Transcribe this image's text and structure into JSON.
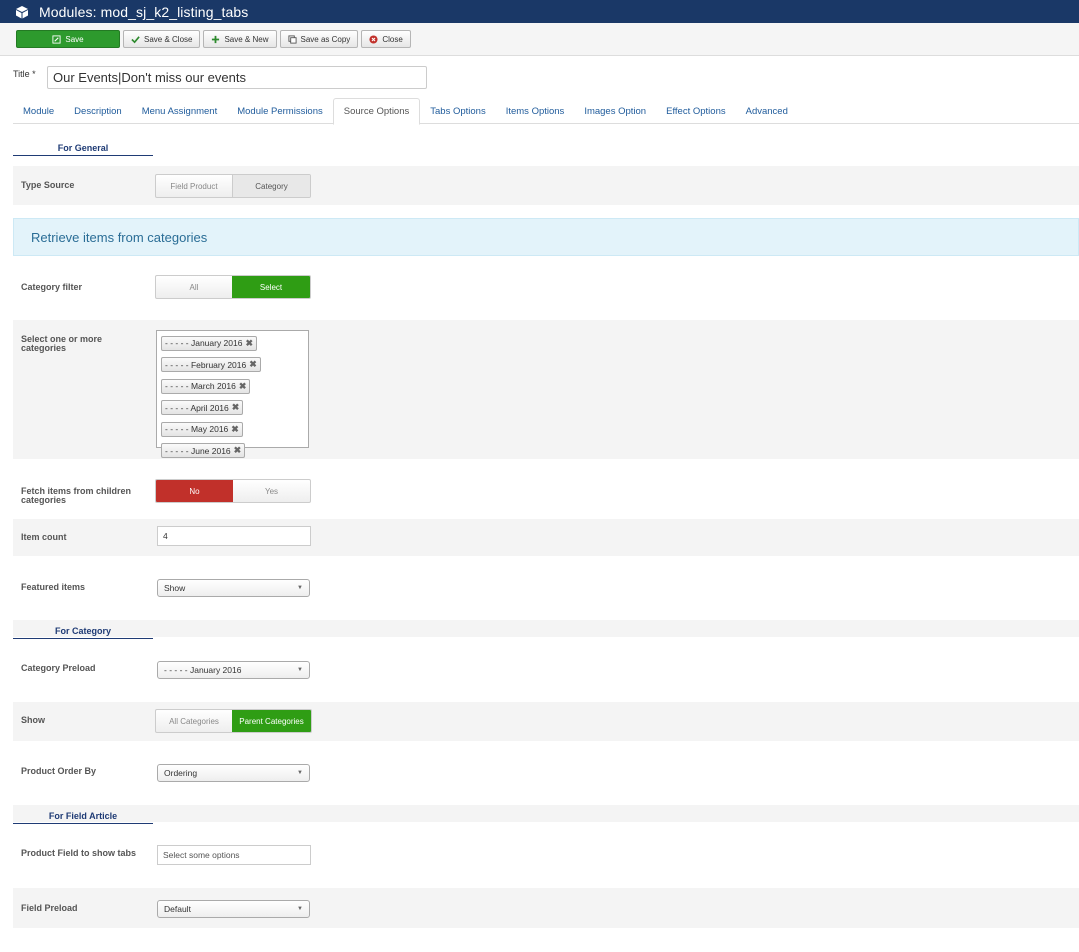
{
  "header": {
    "title": "Modules: mod_sj_k2_listing_tabs",
    "icon": "cube-icon"
  },
  "toolbar": {
    "save": "Save",
    "save_close": "Save & Close",
    "save_new": "Save & New",
    "save_copy": "Save as Copy",
    "close": "Close"
  },
  "title_field": {
    "label": "Title *",
    "value": "Our Events|Don't miss our events"
  },
  "tabs": [
    "Module",
    "Description",
    "Menu Assignment",
    "Module Permissions",
    "Source Options",
    "Tabs Options",
    "Items Options",
    "Images Option",
    "Effect Options",
    "Advanced"
  ],
  "sections": {
    "general": "For General",
    "category": "For Category",
    "field_article": "For Field Article"
  },
  "type_source": {
    "label": "Type Source",
    "options": [
      "Field Product",
      "Category"
    ],
    "selected": "Category"
  },
  "banner": "Retrieve items from categories",
  "category_filter": {
    "label": "Category filter",
    "options": [
      "All",
      "Select"
    ],
    "selected": "Select"
  },
  "categories": {
    "label": "Select one or more categories",
    "items": [
      "- - - - - January 2016",
      "- - - - - February 2016",
      "- - - - - March 2016",
      "- - - - - April 2016",
      "- - - - - May 2016",
      "- - - - - June 2016"
    ]
  },
  "fetch_children": {
    "label": "Fetch items from children categories",
    "options": [
      "No",
      "Yes"
    ],
    "selected": "No"
  },
  "item_count": {
    "label": "Item count",
    "value": "4"
  },
  "featured": {
    "label": "Featured items",
    "value": "Show"
  },
  "category_preload": {
    "label": "Category Preload",
    "value": "- - - - - January 2016"
  },
  "show": {
    "label": "Show",
    "options": [
      "All Categories",
      "Parent Categories"
    ],
    "selected": "Parent Categories"
  },
  "order_by": {
    "label": "Product Order By",
    "value": "Ordering"
  },
  "product_field": {
    "label": "Product Field to show tabs",
    "placeholder": "Select some options"
  },
  "field_preload": {
    "label": "Field Preload",
    "value": "Default"
  },
  "colors": {
    "header": "#1a3867",
    "save": "#2d9a2d",
    "green": "#2f9d14",
    "red": "#c1302a",
    "link": "#1f5b9b"
  }
}
